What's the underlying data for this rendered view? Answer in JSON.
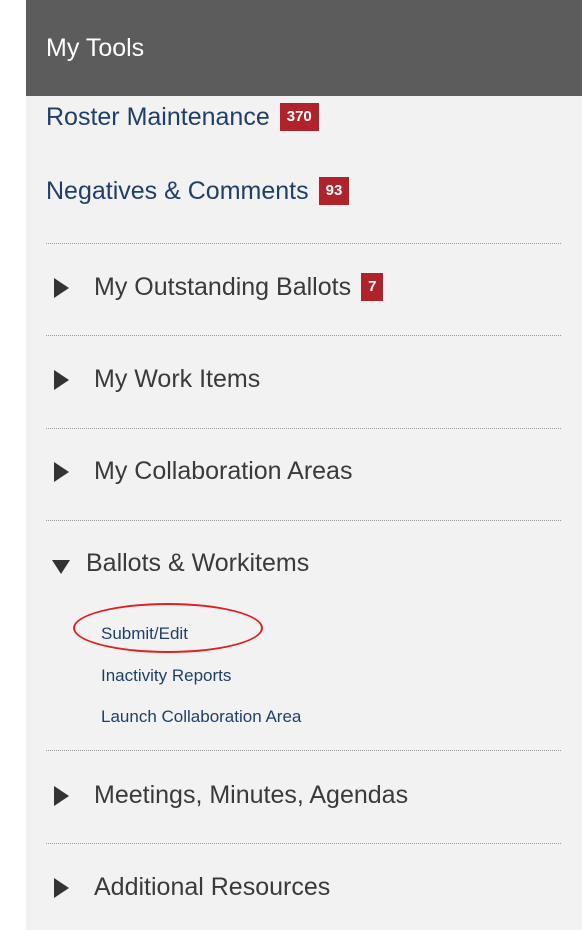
{
  "panel": {
    "title": "My Tools",
    "links": [
      {
        "label": "Roster Maintenance",
        "badge": "370"
      },
      {
        "label": "Negatives & Comments",
        "badge": "93"
      }
    ],
    "sections": [
      {
        "label": "My Outstanding Ballots",
        "badge": "7",
        "expanded": false
      },
      {
        "label": "My Work Items",
        "expanded": false
      },
      {
        "label": "My Collaboration Areas",
        "expanded": false
      },
      {
        "label": "Ballots & Workitems",
        "expanded": true,
        "items": [
          "Submit/Edit",
          "Inactivity Reports",
          "Launch Collaboration Area"
        ]
      },
      {
        "label": "Meetings, Minutes, Agendas",
        "expanded": false
      },
      {
        "label": "Additional Resources",
        "expanded": false
      }
    ]
  },
  "colors": {
    "header_bg": "#5c5c5c",
    "panel_bg": "#f2f2f2",
    "link": "#1f3f6b",
    "badge_bg": "#b0232a",
    "annotation": "#e02020"
  }
}
